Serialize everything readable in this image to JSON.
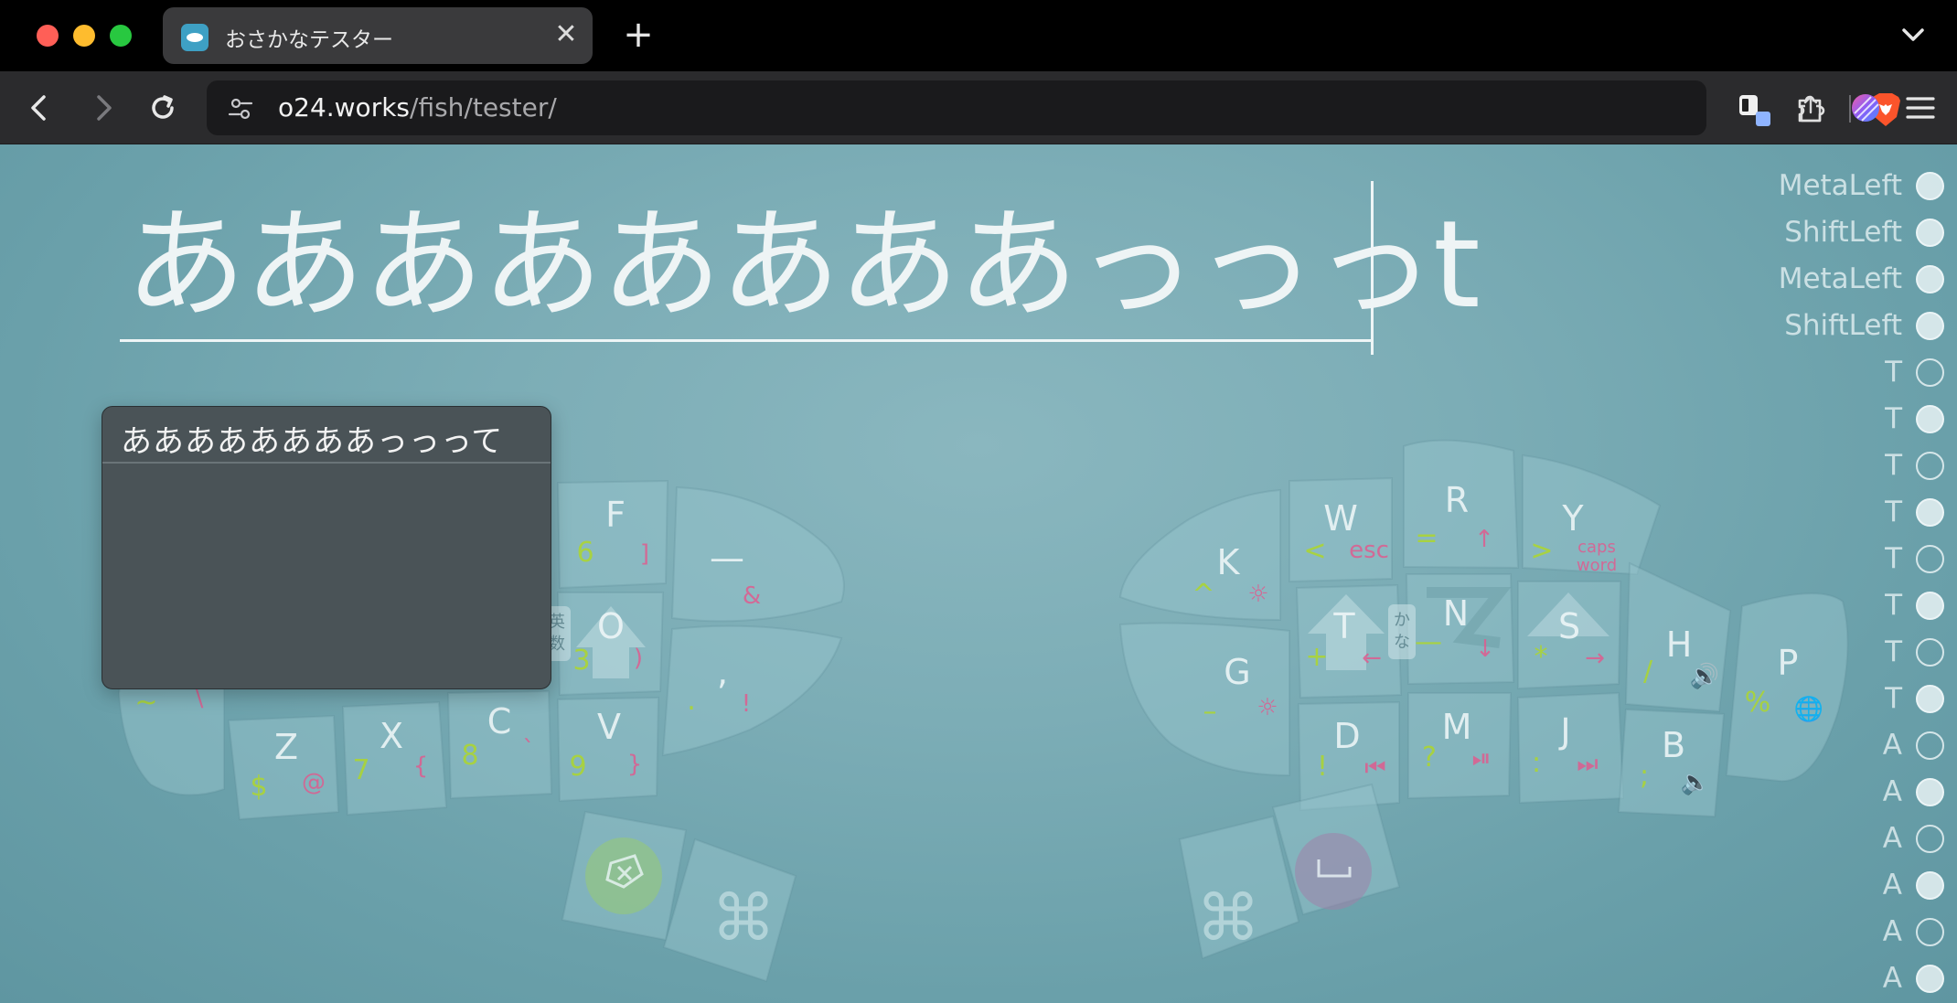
{
  "browser": {
    "tab_title": "おさかなテスター",
    "url_host": "o24.works",
    "url_path": "/fish/tester/",
    "close_symbol": "✕",
    "newtab_symbol": "+"
  },
  "page": {
    "input_text": "ああああああああっっっt",
    "ime_candidate": "ああああああああっっって"
  },
  "keyboard": {
    "keys": [
      {
        "id": "F",
        "label": "F",
        "g": "6",
        "p": "]"
      },
      {
        "id": "dash",
        "label": "—",
        "p": "&"
      },
      {
        "id": "O",
        "label": "O",
        "g": "3",
        "p": ")",
        "mode": "英数"
      },
      {
        "id": "comma",
        "label": ",",
        "g": ".",
        "p": "!"
      },
      {
        "id": "Z",
        "label": "Z",
        "g": "$",
        "p": "@"
      },
      {
        "id": "X",
        "label": "X",
        "g": "7",
        "p": "{"
      },
      {
        "id": "C",
        "label": "C",
        "g": "8",
        "p": "`"
      },
      {
        "id": "V",
        "label": "V",
        "g": "9",
        "p": "}"
      },
      {
        "id": "K",
        "label": "K",
        "g": "^",
        "p": "☼"
      },
      {
        "id": "W",
        "label": "W",
        "g": "<",
        "p": "esc"
      },
      {
        "id": "R",
        "label": "R",
        "g": "=",
        "p": "↑"
      },
      {
        "id": "Y",
        "label": "Y",
        "g": ">",
        "p": "caps word"
      },
      {
        "id": "G",
        "label": "G",
        "g": "–",
        "p": "☼"
      },
      {
        "id": "T",
        "label": "T",
        "g": "+",
        "p": "←",
        "mode": "かな"
      },
      {
        "id": "N",
        "label": "N",
        "g": "—",
        "p": "↓"
      },
      {
        "id": "S",
        "label": "S",
        "g": "*",
        "p": "→"
      },
      {
        "id": "H",
        "label": "H",
        "g": "/",
        "p": "🔊"
      },
      {
        "id": "P",
        "label": "P",
        "g": "%",
        "p": "🌐"
      },
      {
        "id": "D",
        "label": "D",
        "g": "!",
        "p": "⏮"
      },
      {
        "id": "M",
        "label": "M",
        "g": "?",
        "p": "⏯"
      },
      {
        "id": "J",
        "label": "J",
        "g": ":",
        "p": "⏭"
      },
      {
        "id": "B",
        "label": "B",
        "g": ";",
        "p": "🔈"
      },
      {
        "id": "tilde",
        "label": "",
        "g": "~",
        "p": "\\"
      }
    ]
  },
  "key_log": [
    {
      "label": "MetaLeft",
      "on": true
    },
    {
      "label": "ShiftLeft",
      "on": true
    },
    {
      "label": "MetaLeft",
      "on": true
    },
    {
      "label": "ShiftLeft",
      "on": true
    },
    {
      "label": "T",
      "on": false
    },
    {
      "label": "T",
      "on": true
    },
    {
      "label": "T",
      "on": false
    },
    {
      "label": "T",
      "on": true
    },
    {
      "label": "T",
      "on": false
    },
    {
      "label": "T",
      "on": true
    },
    {
      "label": "T",
      "on": false
    },
    {
      "label": "T",
      "on": true
    },
    {
      "label": "A",
      "on": false
    },
    {
      "label": "A",
      "on": true
    },
    {
      "label": "A",
      "on": false
    },
    {
      "label": "A",
      "on": true
    },
    {
      "label": "A",
      "on": false
    },
    {
      "label": "A",
      "on": true
    }
  ],
  "colors": {
    "page_bg": "#7cadb6",
    "ime_bg": "#4a5357",
    "secondary_legend": "#aad23c",
    "tertiary_legend": "#dc5a8c"
  }
}
